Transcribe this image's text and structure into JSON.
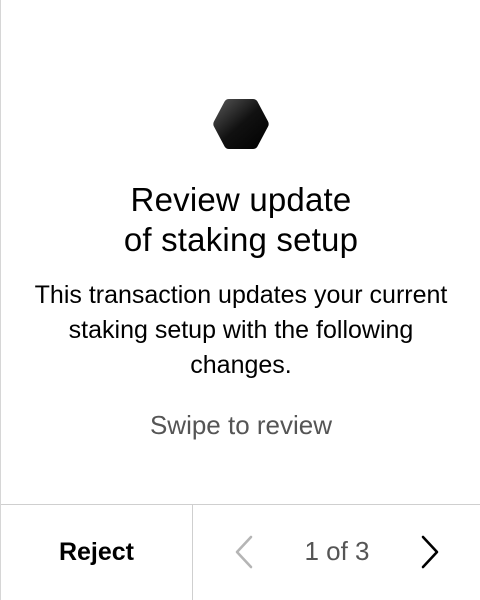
{
  "review": {
    "title": "Review update\nof staking setup",
    "description": "This transaction updates your current staking setup with the following changes.",
    "hint": "Swipe to review"
  },
  "footer": {
    "reject_label": "Reject",
    "pager_text": "1 of 3",
    "prev_icon": "chevron-left-icon",
    "next_icon": "chevron-right-icon"
  },
  "icons": {
    "app_logo": "hexagon-logo-icon"
  },
  "colors": {
    "background": "#ffffff",
    "text_primary": "#000000",
    "text_secondary": "#555555",
    "prev_disabled": "#b5b5b5",
    "divider": "#cfcfcf"
  }
}
